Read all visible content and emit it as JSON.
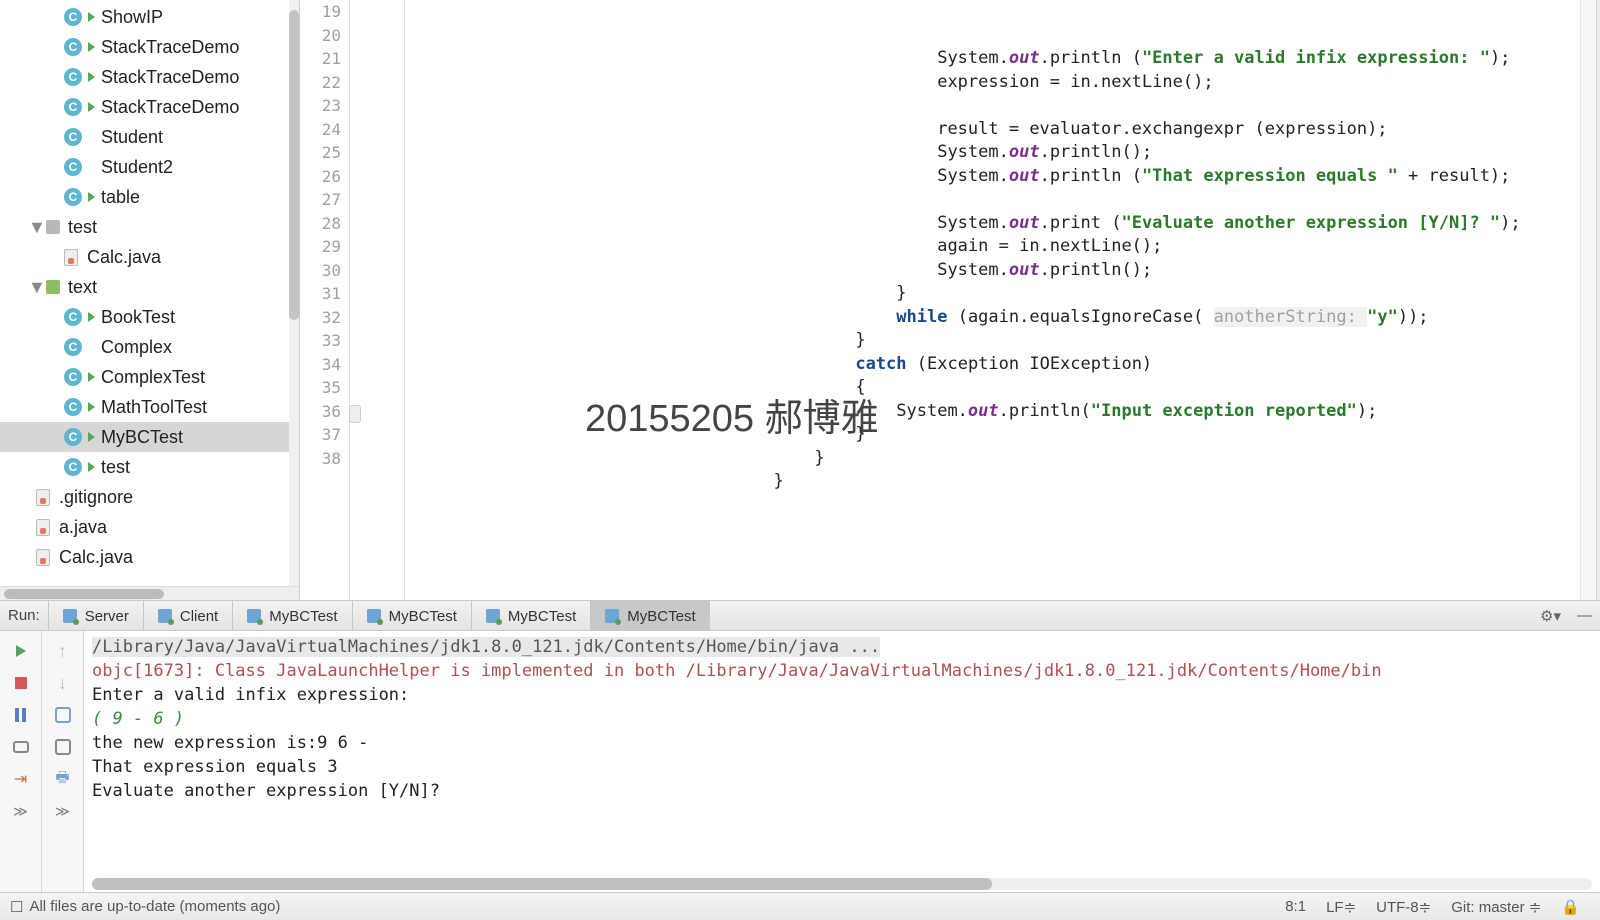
{
  "sidebar": {
    "items": [
      {
        "label": "ShowIP",
        "icon": "class",
        "run": true,
        "pad": "pad3"
      },
      {
        "label": "StackTraceDemo",
        "icon": "class",
        "run": true,
        "pad": "pad3"
      },
      {
        "label": "StackTraceDemo",
        "icon": "class",
        "run": true,
        "pad": "pad3"
      },
      {
        "label": "StackTraceDemo",
        "icon": "class",
        "run": true,
        "pad": "pad3"
      },
      {
        "label": "Student",
        "icon": "class",
        "run": false,
        "pad": "pad3"
      },
      {
        "label": "Student2",
        "icon": "class",
        "run": false,
        "pad": "pad3"
      },
      {
        "label": "table",
        "icon": "class",
        "run": true,
        "pad": "pad3"
      },
      {
        "label": "test",
        "icon": "folder",
        "chev": "▼",
        "pad": "pad1"
      },
      {
        "label": "Calc.java",
        "icon": "file",
        "pad": "pad3"
      },
      {
        "label": "text",
        "icon": "folder-green",
        "chev": "▼",
        "pad": "pad1"
      },
      {
        "label": "BookTest",
        "icon": "class",
        "run": true,
        "pad": "pad3"
      },
      {
        "label": "Complex",
        "icon": "class",
        "run": false,
        "pad": "pad3"
      },
      {
        "label": "ComplexTest",
        "icon": "class",
        "run": true,
        "pad": "pad3"
      },
      {
        "label": "MathToolTest",
        "icon": "class",
        "run": true,
        "pad": "pad3"
      },
      {
        "label": "MyBCTest",
        "icon": "class",
        "run": true,
        "pad": "pad3",
        "sel": true
      },
      {
        "label": "test",
        "icon": "class",
        "run": true,
        "pad": "pad3"
      },
      {
        "label": ".gitignore",
        "icon": "file-plain",
        "pad": "pad2"
      },
      {
        "label": "a.java",
        "icon": "file",
        "pad": "pad2"
      },
      {
        "label": "Calc.java",
        "icon": "file",
        "pad": "pad2"
      }
    ]
  },
  "gutter": {
    "start": 19,
    "end": 38
  },
  "code": {
    "lines": [
      {
        "indent": "                                                    ",
        "tokens": [
          {
            "t": "System."
          },
          {
            "t": "out",
            "c": "fld"
          },
          {
            "t": ".println ("
          },
          {
            "t": "\"Enter a valid infix expression: \"",
            "c": "str"
          },
          {
            "t": ");"
          }
        ]
      },
      {
        "indent": "                                                    ",
        "tokens": [
          {
            "t": "expression = in.nextLine();"
          }
        ]
      },
      {
        "indent": "",
        "tokens": []
      },
      {
        "indent": "                                                    ",
        "tokens": [
          {
            "t": "result = evaluator.exchangexpr (expression);"
          }
        ]
      },
      {
        "indent": "                                                    ",
        "tokens": [
          {
            "t": "System."
          },
          {
            "t": "out",
            "c": "fld"
          },
          {
            "t": ".println();"
          }
        ]
      },
      {
        "indent": "                                                    ",
        "tokens": [
          {
            "t": "System."
          },
          {
            "t": "out",
            "c": "fld"
          },
          {
            "t": ".println ("
          },
          {
            "t": "\"That expression equals \"",
            "c": "str"
          },
          {
            "t": " + result);"
          }
        ]
      },
      {
        "indent": "",
        "tokens": []
      },
      {
        "indent": "                                                    ",
        "tokens": [
          {
            "t": "System."
          },
          {
            "t": "out",
            "c": "fld"
          },
          {
            "t": ".print ("
          },
          {
            "t": "\"Evaluate another expression [Y/N]? \"",
            "c": "str"
          },
          {
            "t": ");"
          }
        ]
      },
      {
        "indent": "                                                    ",
        "tokens": [
          {
            "t": "again = in.nextLine();"
          }
        ]
      },
      {
        "indent": "                                                    ",
        "tokens": [
          {
            "t": "System."
          },
          {
            "t": "out",
            "c": "fld"
          },
          {
            "t": ".println();"
          }
        ]
      },
      {
        "indent": "                                                ",
        "tokens": [
          {
            "t": "}"
          }
        ]
      },
      {
        "indent": "                                                ",
        "tokens": [
          {
            "t": "while",
            "c": "kw"
          },
          {
            "t": " (again.equalsIgnoreCase( "
          },
          {
            "t": "anotherString: ",
            "c": "hint"
          },
          {
            "t": "\"y\"",
            "c": "str"
          },
          {
            "t": "));"
          }
        ]
      },
      {
        "indent": "                                            ",
        "tokens": [
          {
            "t": "}"
          }
        ]
      },
      {
        "indent": "                                            ",
        "tokens": [
          {
            "t": "catch",
            "c": "kw"
          },
          {
            "t": " (Exception IOException)"
          }
        ]
      },
      {
        "indent": "                                            ",
        "tokens": [
          {
            "t": "{"
          }
        ]
      },
      {
        "indent": "                                                ",
        "tokens": [
          {
            "t": "System."
          },
          {
            "t": "out",
            "c": "fld"
          },
          {
            "t": ".println("
          },
          {
            "t": "\"Input exception reported\"",
            "c": "str"
          },
          {
            "t": ");"
          }
        ]
      },
      {
        "indent": "                                            ",
        "tokens": [
          {
            "t": "}"
          }
        ]
      },
      {
        "indent": "                                        ",
        "tokens": [
          {
            "t": "}"
          }
        ]
      },
      {
        "indent": "                                    ",
        "tokens": [
          {
            "t": "}"
          }
        ]
      },
      {
        "indent": "",
        "tokens": []
      }
    ]
  },
  "watermark": "20155205 郝博雅",
  "run": {
    "label": "Run:",
    "tabs": [
      "Server",
      "Client",
      "MyBCTest",
      "MyBCTest",
      "MyBCTest",
      "MyBCTest"
    ],
    "active_index": 5,
    "console": {
      "path": "/Library/Java/JavaVirtualMachines/jdk1.8.0_121.jdk/Contents/Home/bin/java ...",
      "err": "objc[1673]: Class JavaLaunchHelper is implemented in both /Library/Java/JavaVirtualMachines/jdk1.8.0_121.jdk/Contents/Home/bin",
      "l3": "Enter a valid infix expression:",
      "l4": "( 9 - 6 )",
      "l5": "the new expression is:9 6 -",
      "l6": "",
      "l7": "That expression equals 3",
      "l8": "Evaluate another expression [Y/N]?"
    }
  },
  "status": {
    "vcs": "All files are up-to-date (moments ago)",
    "pos": "8:1",
    "le": "LF≑",
    "enc": "UTF-8≑",
    "git": "Git: master ≑"
  }
}
